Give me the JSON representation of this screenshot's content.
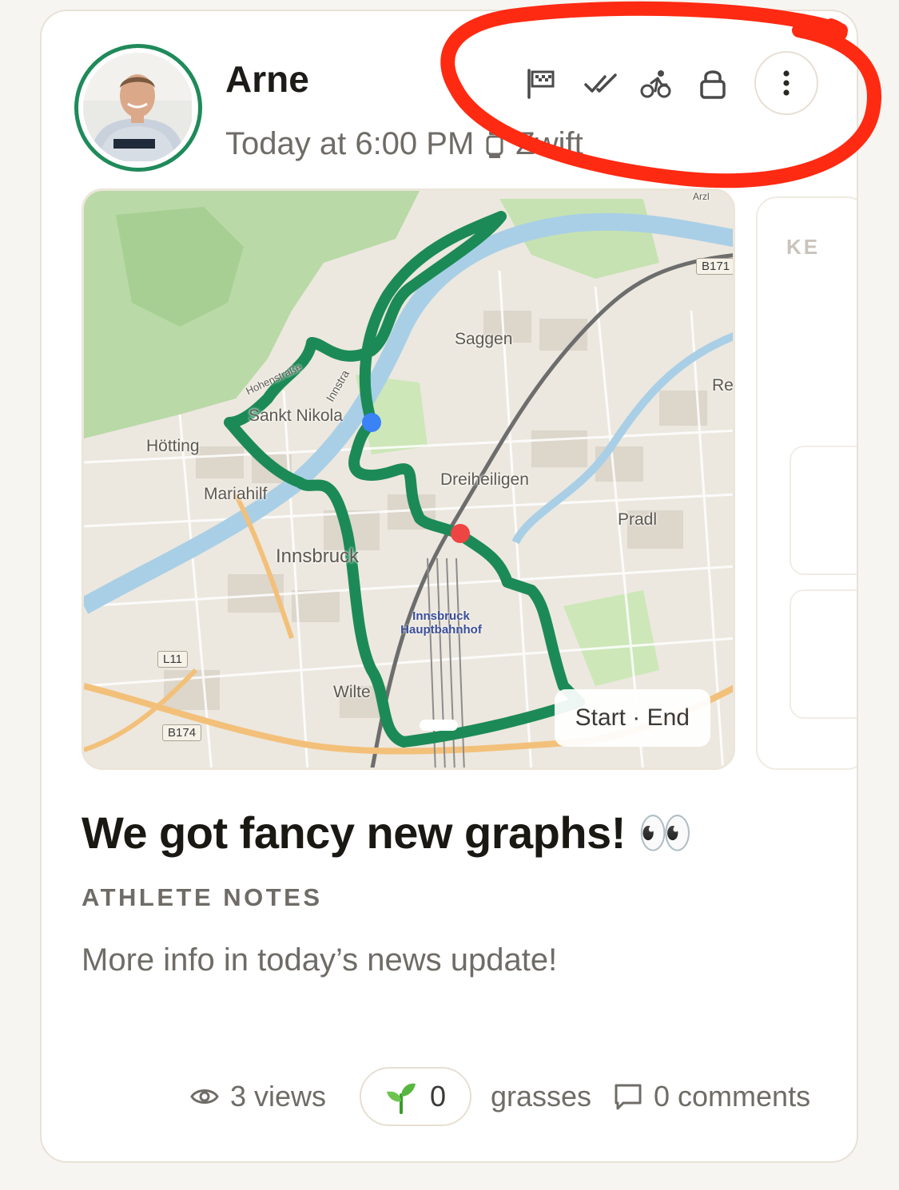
{
  "post": {
    "athlete_name": "Arne",
    "timestamp": "Today at 6:00 PM",
    "device": "Zwift",
    "title": "We got fancy new graphs! 👀",
    "notes_label": "ATHLETE NOTES",
    "notes_body": "More info in today’s news update!"
  },
  "header_icons": [
    "race-flag-icon",
    "double-check-icon",
    "bike-icon",
    "lock-icon",
    "more-vertical-icon"
  ],
  "map": {
    "labels": {
      "saggen": "Saggen",
      "sankt_nikolaus": "Sankt Nikola",
      "hoetting": "Hötting",
      "mariahilf": "Mariahilf",
      "innsbruck": "Innsbruck",
      "dreiheiligen": "Dreiheiligen",
      "pradl": "Pradl",
      "wilten": "Wilte",
      "hohenstrasse": "Hohenstraße",
      "innstrasse": "Innstra",
      "re": "Re",
      "arzl": "Arzl",
      "station": "Innsbruck Hauptbahnhof"
    },
    "road_badges": {
      "b171": "B171",
      "l11": "L11",
      "b174": "B174"
    },
    "legend": "Start · End",
    "route_color": "#1c8a57",
    "start_color": "#3b82f6",
    "end_color": "#ef4444"
  },
  "side_panel": {
    "title": "KE"
  },
  "footer": {
    "views": "3 views",
    "grass_count": "0",
    "grass_label": "grasses",
    "comments": "0 comments"
  },
  "colors": {
    "accent": "#1f8a5a",
    "annotation": "#ff2a12",
    "text_secondary": "#6f6c67"
  }
}
